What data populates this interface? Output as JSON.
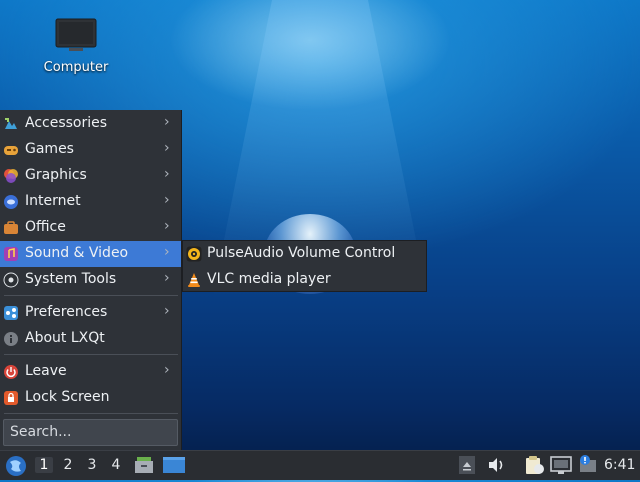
{
  "desktop": {
    "computer_label": "Computer"
  },
  "menu": {
    "items": [
      {
        "label": "Accessories",
        "icon": "accessories-icon",
        "color": "#3fa0d8"
      },
      {
        "label": "Games",
        "icon": "games-icon",
        "color": "#e8a33a"
      },
      {
        "label": "Graphics",
        "icon": "graphics-icon",
        "color": "#e2513c"
      },
      {
        "label": "Internet",
        "icon": "internet-icon",
        "color": "#3a6fd8"
      },
      {
        "label": "Office",
        "icon": "office-icon",
        "color": "#d98536"
      },
      {
        "label": "Sound & Video",
        "icon": "sound-video-icon",
        "color": "#a23fb4"
      },
      {
        "label": "System Tools",
        "icon": "system-tools-icon",
        "color": "#dfe3e7"
      },
      {
        "label": "Preferences",
        "icon": "preferences-icon",
        "color": "#3a8fd8"
      },
      {
        "label": "About LXQt",
        "icon": "about-icon",
        "color": "#7a7f86"
      },
      {
        "label": "Leave",
        "icon": "leave-icon",
        "color": "#d8453a"
      },
      {
        "label": "Lock Screen",
        "icon": "lock-icon",
        "color": "#e25a2c"
      }
    ],
    "arrow": "›",
    "search_placeholder": "Search..."
  },
  "submenu": {
    "items": [
      {
        "label": "PulseAudio Volume Control",
        "icon": "pulseaudio-icon"
      },
      {
        "label": "VLC media player",
        "icon": "vlc-icon"
      }
    ]
  },
  "panel": {
    "desktops": [
      "1",
      "2",
      "3",
      "4"
    ],
    "clock": "6:41",
    "accent": "#3d7ad6"
  }
}
